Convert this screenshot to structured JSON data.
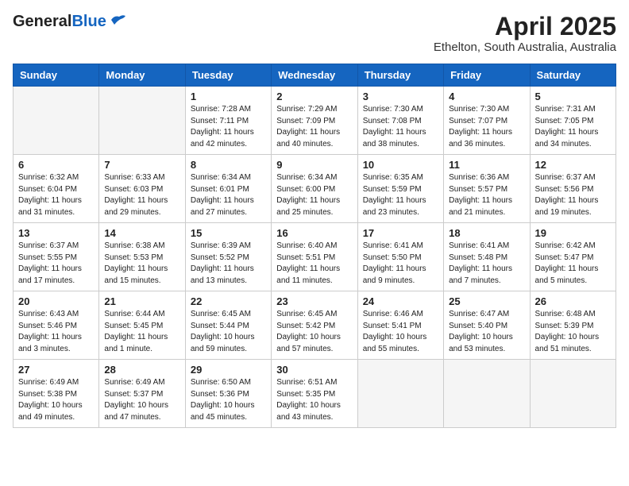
{
  "header": {
    "logo_general": "General",
    "logo_blue": "Blue",
    "month_year": "April 2025",
    "location": "Ethelton, South Australia, Australia"
  },
  "days_of_week": [
    "Sunday",
    "Monday",
    "Tuesday",
    "Wednesday",
    "Thursday",
    "Friday",
    "Saturday"
  ],
  "weeks": [
    [
      {
        "day": "",
        "sunrise": "",
        "sunset": "",
        "daylight": ""
      },
      {
        "day": "",
        "sunrise": "",
        "sunset": "",
        "daylight": ""
      },
      {
        "day": "1",
        "sunrise": "Sunrise: 7:28 AM",
        "sunset": "Sunset: 7:11 PM",
        "daylight": "Daylight: 11 hours and 42 minutes."
      },
      {
        "day": "2",
        "sunrise": "Sunrise: 7:29 AM",
        "sunset": "Sunset: 7:09 PM",
        "daylight": "Daylight: 11 hours and 40 minutes."
      },
      {
        "day": "3",
        "sunrise": "Sunrise: 7:30 AM",
        "sunset": "Sunset: 7:08 PM",
        "daylight": "Daylight: 11 hours and 38 minutes."
      },
      {
        "day": "4",
        "sunrise": "Sunrise: 7:30 AM",
        "sunset": "Sunset: 7:07 PM",
        "daylight": "Daylight: 11 hours and 36 minutes."
      },
      {
        "day": "5",
        "sunrise": "Sunrise: 7:31 AM",
        "sunset": "Sunset: 7:05 PM",
        "daylight": "Daylight: 11 hours and 34 minutes."
      }
    ],
    [
      {
        "day": "6",
        "sunrise": "Sunrise: 6:32 AM",
        "sunset": "Sunset: 6:04 PM",
        "daylight": "Daylight: 11 hours and 31 minutes."
      },
      {
        "day": "7",
        "sunrise": "Sunrise: 6:33 AM",
        "sunset": "Sunset: 6:03 PM",
        "daylight": "Daylight: 11 hours and 29 minutes."
      },
      {
        "day": "8",
        "sunrise": "Sunrise: 6:34 AM",
        "sunset": "Sunset: 6:01 PM",
        "daylight": "Daylight: 11 hours and 27 minutes."
      },
      {
        "day": "9",
        "sunrise": "Sunrise: 6:34 AM",
        "sunset": "Sunset: 6:00 PM",
        "daylight": "Daylight: 11 hours and 25 minutes."
      },
      {
        "day": "10",
        "sunrise": "Sunrise: 6:35 AM",
        "sunset": "Sunset: 5:59 PM",
        "daylight": "Daylight: 11 hours and 23 minutes."
      },
      {
        "day": "11",
        "sunrise": "Sunrise: 6:36 AM",
        "sunset": "Sunset: 5:57 PM",
        "daylight": "Daylight: 11 hours and 21 minutes."
      },
      {
        "day": "12",
        "sunrise": "Sunrise: 6:37 AM",
        "sunset": "Sunset: 5:56 PM",
        "daylight": "Daylight: 11 hours and 19 minutes."
      }
    ],
    [
      {
        "day": "13",
        "sunrise": "Sunrise: 6:37 AM",
        "sunset": "Sunset: 5:55 PM",
        "daylight": "Daylight: 11 hours and 17 minutes."
      },
      {
        "day": "14",
        "sunrise": "Sunrise: 6:38 AM",
        "sunset": "Sunset: 5:53 PM",
        "daylight": "Daylight: 11 hours and 15 minutes."
      },
      {
        "day": "15",
        "sunrise": "Sunrise: 6:39 AM",
        "sunset": "Sunset: 5:52 PM",
        "daylight": "Daylight: 11 hours and 13 minutes."
      },
      {
        "day": "16",
        "sunrise": "Sunrise: 6:40 AM",
        "sunset": "Sunset: 5:51 PM",
        "daylight": "Daylight: 11 hours and 11 minutes."
      },
      {
        "day": "17",
        "sunrise": "Sunrise: 6:41 AM",
        "sunset": "Sunset: 5:50 PM",
        "daylight": "Daylight: 11 hours and 9 minutes."
      },
      {
        "day": "18",
        "sunrise": "Sunrise: 6:41 AM",
        "sunset": "Sunset: 5:48 PM",
        "daylight": "Daylight: 11 hours and 7 minutes."
      },
      {
        "day": "19",
        "sunrise": "Sunrise: 6:42 AM",
        "sunset": "Sunset: 5:47 PM",
        "daylight": "Daylight: 11 hours and 5 minutes."
      }
    ],
    [
      {
        "day": "20",
        "sunrise": "Sunrise: 6:43 AM",
        "sunset": "Sunset: 5:46 PM",
        "daylight": "Daylight: 11 hours and 3 minutes."
      },
      {
        "day": "21",
        "sunrise": "Sunrise: 6:44 AM",
        "sunset": "Sunset: 5:45 PM",
        "daylight": "Daylight: 11 hours and 1 minute."
      },
      {
        "day": "22",
        "sunrise": "Sunrise: 6:45 AM",
        "sunset": "Sunset: 5:44 PM",
        "daylight": "Daylight: 10 hours and 59 minutes."
      },
      {
        "day": "23",
        "sunrise": "Sunrise: 6:45 AM",
        "sunset": "Sunset: 5:42 PM",
        "daylight": "Daylight: 10 hours and 57 minutes."
      },
      {
        "day": "24",
        "sunrise": "Sunrise: 6:46 AM",
        "sunset": "Sunset: 5:41 PM",
        "daylight": "Daylight: 10 hours and 55 minutes."
      },
      {
        "day": "25",
        "sunrise": "Sunrise: 6:47 AM",
        "sunset": "Sunset: 5:40 PM",
        "daylight": "Daylight: 10 hours and 53 minutes."
      },
      {
        "day": "26",
        "sunrise": "Sunrise: 6:48 AM",
        "sunset": "Sunset: 5:39 PM",
        "daylight": "Daylight: 10 hours and 51 minutes."
      }
    ],
    [
      {
        "day": "27",
        "sunrise": "Sunrise: 6:49 AM",
        "sunset": "Sunset: 5:38 PM",
        "daylight": "Daylight: 10 hours and 49 minutes."
      },
      {
        "day": "28",
        "sunrise": "Sunrise: 6:49 AM",
        "sunset": "Sunset: 5:37 PM",
        "daylight": "Daylight: 10 hours and 47 minutes."
      },
      {
        "day": "29",
        "sunrise": "Sunrise: 6:50 AM",
        "sunset": "Sunset: 5:36 PM",
        "daylight": "Daylight: 10 hours and 45 minutes."
      },
      {
        "day": "30",
        "sunrise": "Sunrise: 6:51 AM",
        "sunset": "Sunset: 5:35 PM",
        "daylight": "Daylight: 10 hours and 43 minutes."
      },
      {
        "day": "",
        "sunrise": "",
        "sunset": "",
        "daylight": ""
      },
      {
        "day": "",
        "sunrise": "",
        "sunset": "",
        "daylight": ""
      },
      {
        "day": "",
        "sunrise": "",
        "sunset": "",
        "daylight": ""
      }
    ]
  ]
}
